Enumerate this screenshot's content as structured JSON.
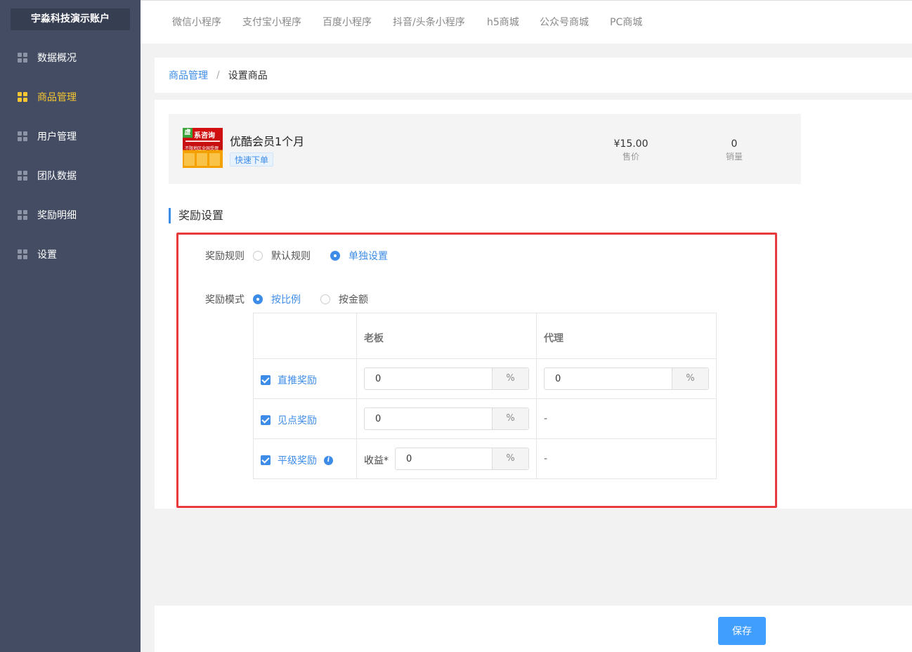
{
  "sidebar": {
    "account": "宇淼科技演示账户",
    "items": [
      {
        "label": "数据概况"
      },
      {
        "label": "商品管理"
      },
      {
        "label": "用户管理"
      },
      {
        "label": "团队数据"
      },
      {
        "label": "奖励明细"
      },
      {
        "label": "设置"
      }
    ],
    "active": "商品管理",
    "active_color": "#f7c631"
  },
  "topbar": {
    "tabs": [
      "微信小程序",
      "支付宝小程序",
      "百度小程序",
      "抖音/头条小程序",
      "h5商城",
      "公众号商城",
      "PC商城"
    ]
  },
  "breadcrumb": {
    "parent": "商品管理",
    "separator": "/",
    "current": "设置商品"
  },
  "product": {
    "name": "优酷会员1个月",
    "tag": "快速下单",
    "price": "¥15.00",
    "price_label": "售价",
    "sales": "0",
    "sales_label": "销量",
    "thumb_text": {
      "corner": "虚",
      "title": "系咨询",
      "line": "不限地区全国受理"
    }
  },
  "reward": {
    "section_title": "奖励设置",
    "rule_label": "奖励规则",
    "rule_options": [
      "默认规则",
      "单独设置"
    ],
    "rule_selected": "单独设置",
    "mode_label": "奖励模式",
    "mode_options": [
      "按比例",
      "按金额"
    ],
    "mode_selected": "按比例",
    "table": {
      "headers": [
        "",
        "老板",
        "代理"
      ],
      "rows": [
        {
          "label": "直推奖励",
          "boss_value": "0",
          "agent_value": "0"
        },
        {
          "label": "见点奖励",
          "boss_value": "0",
          "agent_value": "-"
        },
        {
          "label": "平级奖励",
          "yield_label": "收益*",
          "boss_value": "0",
          "agent_value": "-"
        }
      ],
      "unit": "%"
    }
  },
  "footer": {
    "save_label": "保存"
  },
  "colors": {
    "accent": "#3d8ce8",
    "sidebar_bg": "#434c63",
    "highlight_border": "#e8393d",
    "button": "#409eff"
  }
}
